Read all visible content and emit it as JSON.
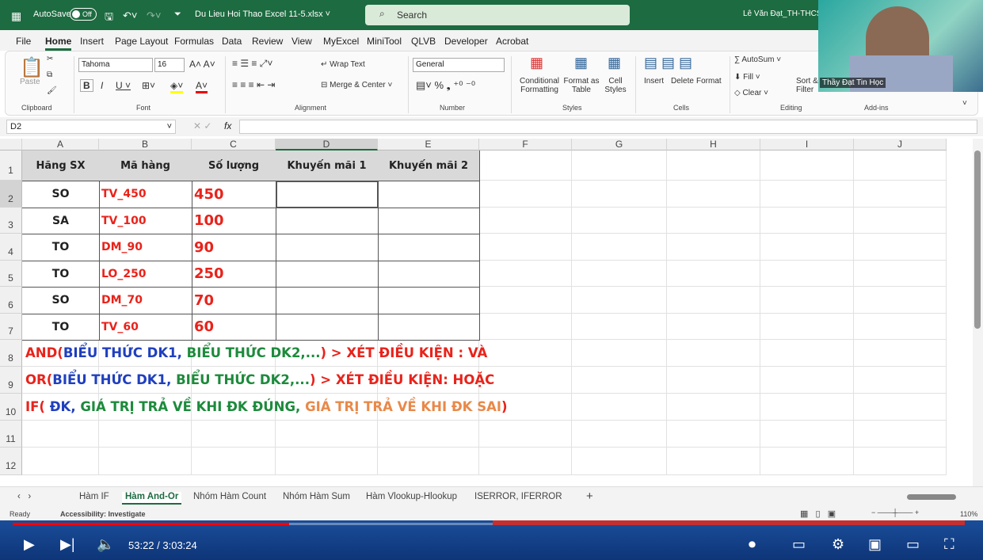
{
  "titlebar": {
    "autosave": "AutoSave",
    "autosave_state": "Off",
    "filename": "Du Lieu Hoi Thao Excel 11-5.xlsx",
    "search_placeholder": "Search",
    "user": "Lê Văn Đạt_TH-THCS-T"
  },
  "ribbon_tabs": [
    "File",
    "Home",
    "Insert",
    "Page Layout",
    "Formulas",
    "Data",
    "Review",
    "View",
    "MyExcel",
    "MiniTool",
    "QLVB",
    "Developer",
    "Acrobat"
  ],
  "ribbon": {
    "paste": "Paste",
    "font_name": "Tahoma",
    "font_size": "16",
    "wrap_text": "Wrap Text",
    "merge_center": "Merge & Center",
    "number_format": "General",
    "conditional_formatting": "Conditional Formatting",
    "format_as_table": "Format as Table",
    "cell_styles": "Cell Styles",
    "insert": "Insert",
    "delete": "Delete",
    "format": "Format",
    "autosum": "AutoSum",
    "fill": "Fill",
    "clear": "Clear",
    "sort_filter": "Sort & Filter",
    "groups": {
      "clipboard": "Clipboard",
      "font": "Font",
      "alignment": "Alignment",
      "number": "Number",
      "styles": "Styles",
      "cells": "Cells",
      "editing": "Editing",
      "addins": "Add-ins"
    }
  },
  "formula_bar": {
    "name_box": "D2",
    "fx": "fx",
    "value": ""
  },
  "columns": [
    "A",
    "B",
    "C",
    "D",
    "E",
    "F",
    "G",
    "H",
    "I",
    "J"
  ],
  "rows": [
    "1",
    "2",
    "3",
    "4",
    "5",
    "6",
    "7",
    "8",
    "9",
    "10",
    "11",
    "12"
  ],
  "table": {
    "headers": [
      "Hãng SX",
      "Mã hàng",
      "Số lượng",
      "Khuyến mãi 1",
      "Khuyến mãi 2"
    ],
    "data": [
      [
        "SO",
        "TV_450",
        "450"
      ],
      [
        "SA",
        "TV_100",
        "100"
      ],
      [
        "TO",
        "DM_90",
        "90"
      ],
      [
        "TO",
        "LO_250",
        "250"
      ],
      [
        "SO",
        "DM_70",
        "70"
      ],
      [
        "TO",
        "TV_60",
        "60"
      ]
    ]
  },
  "notes": [
    [
      {
        "t": "AND(",
        "c": "#e8231b"
      },
      {
        "t": "BIỂU THỨC DK1",
        "c": "#1f3fbf"
      },
      {
        "t": ", ",
        "c": "#1f3fbf"
      },
      {
        "t": "BIỂU THỨC DK2,...",
        "c": "#1d8a3c"
      },
      {
        "t": ") > XÉT ĐIỀU KIỆN : VÀ",
        "c": "#e8231b"
      }
    ],
    [
      {
        "t": "OR(",
        "c": "#e8231b"
      },
      {
        "t": "BIỂU THỨC DK1",
        "c": "#1f3fbf"
      },
      {
        "t": ", ",
        "c": "#1f3fbf"
      },
      {
        "t": "BIỂU THỨC DK2,...",
        "c": "#1d8a3c"
      },
      {
        "t": ") > XÉT ĐIỀU KIỆN: HOẶC",
        "c": "#e8231b"
      }
    ],
    [
      {
        "t": "IF( ",
        "c": "#e8231b"
      },
      {
        "t": "ĐK, ",
        "c": "#1f3fbf"
      },
      {
        "t": "GIÁ TRỊ TRẢ VỀ KHI ĐK ĐÚNG, ",
        "c": "#1d8a3c"
      },
      {
        "t": "GIÁ TRỊ TRẢ VỀ KHI ĐK SAI",
        "c": "#e8894a"
      },
      {
        "t": ")",
        "c": "#e8231b"
      }
    ]
  ],
  "sheet_tabs": [
    "Hàm IF",
    "Hàm And-Or",
    "Nhóm Hàm Count",
    "Nhóm Hàm Sum",
    "Hàm Vlookup-Hlookup",
    "ISERROR, IFERROR"
  ],
  "active_sheet": "Hàm And-Or",
  "status": {
    "ready": "Ready",
    "accessibility": "Accessibility: Investigate",
    "zoom": "110%"
  },
  "player": {
    "time": "53:22 / 3:03:24",
    "progress": 0.29
  },
  "webcam": {
    "caption": "Thầy Đạt Tin Học"
  },
  "colors": {
    "excel_green": "#1d6b40",
    "red": "#e8231b",
    "blue": "#1f3fbf",
    "green": "#1d8a3c",
    "orange": "#e8894a"
  }
}
